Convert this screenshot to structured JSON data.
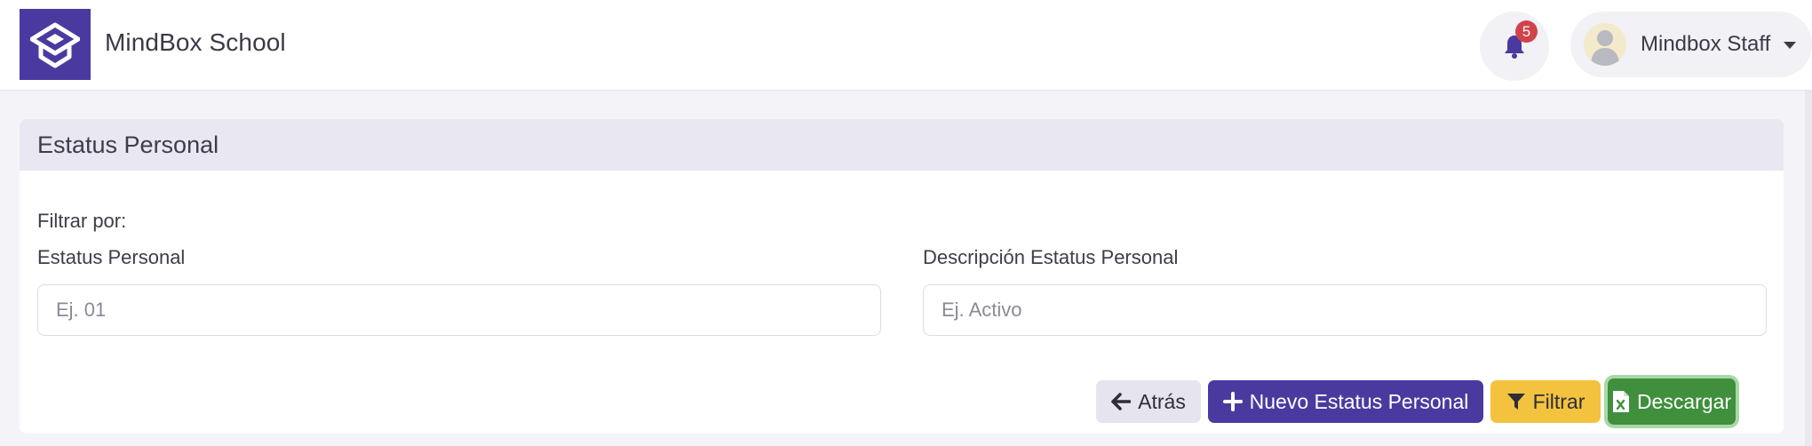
{
  "app": {
    "brand_name": "MindBox School",
    "brand_color": "#4a3aa0"
  },
  "header": {
    "notifications": {
      "count": "5",
      "icon": "bell-icon"
    },
    "user": {
      "name": "Mindbox Staff",
      "avatar_icon": "user-silhouette-icon"
    }
  },
  "card": {
    "title": "Estatus Personal",
    "filter_caption": "Filtrar por:",
    "fields": [
      {
        "label": "Estatus Personal",
        "placeholder": "Ej. 01",
        "value": ""
      },
      {
        "label": "Descripción Estatus Personal",
        "placeholder": "Ej. Activo",
        "value": ""
      }
    ]
  },
  "actions": {
    "back": {
      "label": "Atrás",
      "icon": "arrow-left-icon",
      "color": "#e6e4ef"
    },
    "new": {
      "label": "Nuevo Estatus Personal",
      "icon": "plus-icon",
      "color": "#4a3aa0"
    },
    "filter": {
      "label": "Filtrar",
      "icon": "filter-icon",
      "color": "#f3c33f"
    },
    "download": {
      "label": "Descargar",
      "icon": "excel-file-icon",
      "color": "#3f8f3d"
    }
  }
}
